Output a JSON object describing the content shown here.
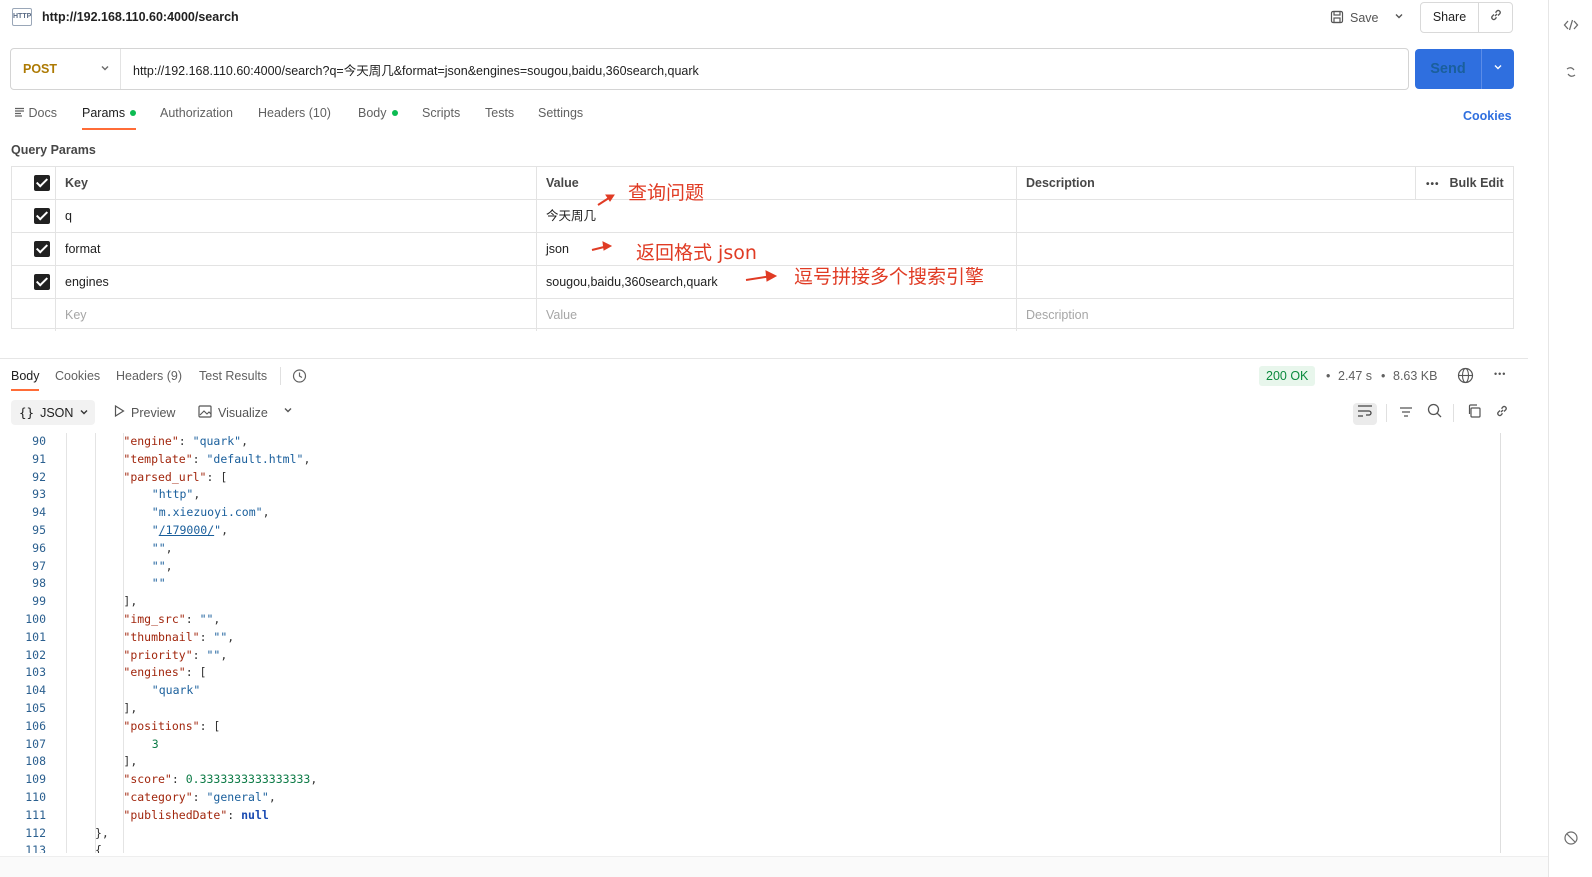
{
  "header": {
    "http_badge": "HTTP",
    "title": "http://192.168.110.60:4000/search",
    "save_label": "Save",
    "share_label": "Share"
  },
  "request": {
    "method": "POST",
    "url": "http://192.168.110.60:4000/search?q=今天周几&format=json&engines=sougou,baidu,360search,quark",
    "send_label": "Send"
  },
  "tabs": {
    "docs": "Docs",
    "params": "Params",
    "authorization": "Authorization",
    "headers": "Headers (10)",
    "body": "Body",
    "scripts": "Scripts",
    "tests": "Tests",
    "settings": "Settings",
    "cookies": "Cookies"
  },
  "query_params": {
    "title": "Query Params",
    "columns": {
      "key": "Key",
      "value": "Value",
      "description": "Description",
      "bulk_edit": "Bulk Edit"
    },
    "rows": [
      {
        "key": "q",
        "value": "今天周几",
        "checked": true
      },
      {
        "key": "format",
        "value": "json",
        "checked": true
      },
      {
        "key": "engines",
        "value": "sougou,baidu,360search,quark",
        "checked": true
      }
    ],
    "placeholder": {
      "key": "Key",
      "value": "Value",
      "description": "Description"
    }
  },
  "annotations": {
    "a1": "查询问题",
    "a2": "返回格式 json",
    "a3": "逗号拼接多个搜索引擎"
  },
  "response": {
    "tabs": {
      "body": "Body",
      "cookies": "Cookies",
      "headers": "Headers (9)",
      "test_results": "Test Results"
    },
    "status": "200 OK",
    "time": "2.47 s",
    "size": "8.63 KB",
    "format": "JSON",
    "preview": "Preview",
    "visualize": "Visualize"
  },
  "code_lines": [
    {
      "n": "90",
      "i": 2,
      "html": "<span class='k'>\"engine\"</span><span class='p'>: </span><span class='s'>\"quark\"</span><span class='p'>,</span>"
    },
    {
      "n": "91",
      "i": 2,
      "html": "<span class='k'>\"template\"</span><span class='p'>: </span><span class='s'>\"default.html\"</span><span class='p'>,</span>"
    },
    {
      "n": "92",
      "i": 2,
      "html": "<span class='k'>\"parsed_url\"</span><span class='p'>: [</span>"
    },
    {
      "n": "93",
      "i": 3,
      "html": "<span class='s'>\"http\"</span><span class='p'>,</span>"
    },
    {
      "n": "94",
      "i": 3,
      "html": "<span class='s'>\"m.xiezuoyi.com\"</span><span class='p'>,</span>"
    },
    {
      "n": "95",
      "i": 3,
      "html": "<span class='s'>\"</span><span class='u'>/179000/</span><span class='s'>\"</span><span class='p'>,</span>"
    },
    {
      "n": "96",
      "i": 3,
      "html": "<span class='s'>\"\"</span><span class='p'>,</span>"
    },
    {
      "n": "97",
      "i": 3,
      "html": "<span class='s'>\"\"</span><span class='p'>,</span>"
    },
    {
      "n": "98",
      "i": 3,
      "html": "<span class='s'>\"\"</span>"
    },
    {
      "n": "99",
      "i": 2,
      "html": "<span class='p'>],</span>"
    },
    {
      "n": "100",
      "i": 2,
      "html": "<span class='k'>\"img_src\"</span><span class='p'>: </span><span class='s'>\"\"</span><span class='p'>,</span>"
    },
    {
      "n": "101",
      "i": 2,
      "html": "<span class='k'>\"thumbnail\"</span><span class='p'>: </span><span class='s'>\"\"</span><span class='p'>,</span>"
    },
    {
      "n": "102",
      "i": 2,
      "html": "<span class='k'>\"priority\"</span><span class='p'>: </span><span class='s'>\"\"</span><span class='p'>,</span>"
    },
    {
      "n": "103",
      "i": 2,
      "html": "<span class='k'>\"engines\"</span><span class='p'>: [</span>"
    },
    {
      "n": "104",
      "i": 3,
      "html": "<span class='s'>\"quark\"</span>"
    },
    {
      "n": "105",
      "i": 2,
      "html": "<span class='p'>],</span>"
    },
    {
      "n": "106",
      "i": 2,
      "html": "<span class='k'>\"positions\"</span><span class='p'>: [</span>"
    },
    {
      "n": "107",
      "i": 3,
      "html": "<span class='n'>3</span>"
    },
    {
      "n": "108",
      "i": 2,
      "html": "<span class='p'>],</span>"
    },
    {
      "n": "109",
      "i": 2,
      "html": "<span class='k'>\"score\"</span><span class='p'>: </span><span class='n'>0.3333333333333333</span><span class='p'>,</span>"
    },
    {
      "n": "110",
      "i": 2,
      "html": "<span class='k'>\"category\"</span><span class='p'>: </span><span class='s'>\"general\"</span><span class='p'>,</span>"
    },
    {
      "n": "111",
      "i": 2,
      "html": "<span class='k'>\"publishedDate\"</span><span class='p'>: </span><span class='kw'>null</span>"
    },
    {
      "n": "112",
      "i": 1,
      "html": "<span class='p'>},</span>"
    },
    {
      "n": "113",
      "i": 1,
      "html": "<span class='p'>{</span>"
    }
  ]
}
